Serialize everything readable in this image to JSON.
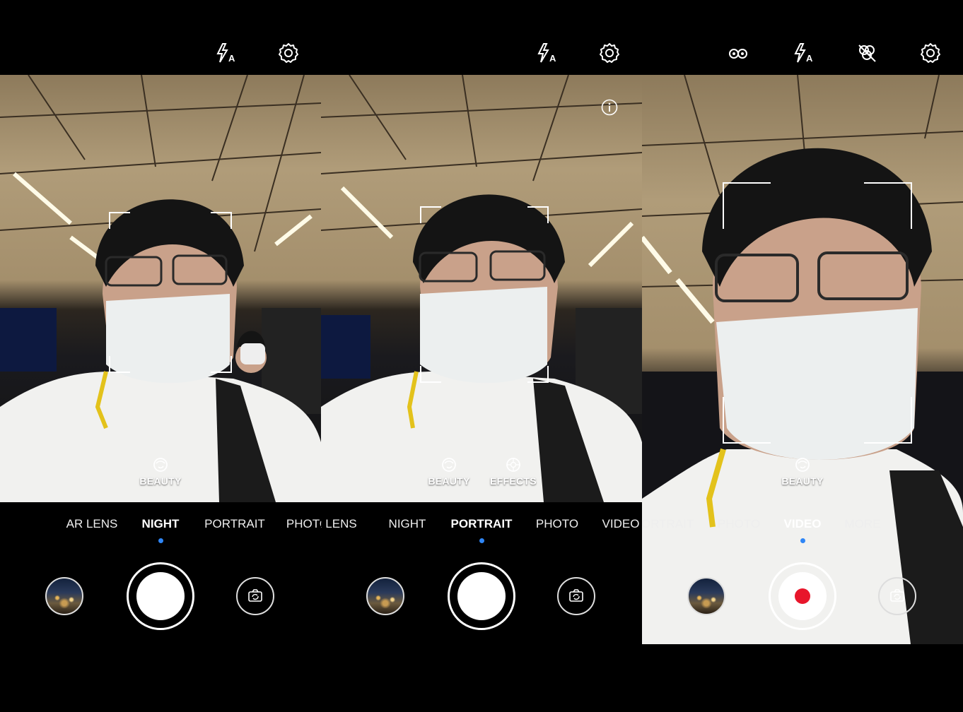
{
  "panels": [
    {
      "top_icons": [
        "flash-auto-icon",
        "settings-gear-icon"
      ],
      "viewfinder_chips": [
        {
          "icon": "beauty-face-icon",
          "label": "BEAUTY"
        }
      ],
      "modes": [
        "AR LENS",
        "NIGHT",
        "PORTRAIT",
        "PHOTO"
      ],
      "active_mode": "NIGHT",
      "shutter": "photo",
      "controls": [
        "gallery-thumbnail",
        "shutter-button",
        "switch-camera-button"
      ]
    },
    {
      "top_icons": [
        "flash-auto-icon",
        "settings-gear-icon",
        "info-icon"
      ],
      "viewfinder_chips": [
        {
          "icon": "beauty-face-icon",
          "label": "BEAUTY"
        },
        {
          "icon": "effects-aperture-icon",
          "label": "EFFECTS"
        }
      ],
      "modes": [
        "R LENS",
        "NIGHT",
        "PORTRAIT",
        "PHOTO",
        "VIDEO"
      ],
      "active_mode": "PORTRAIT",
      "shutter": "photo",
      "controls": [
        "gallery-thumbnail",
        "shutter-button",
        "switch-camera-button"
      ]
    },
    {
      "top_icons": [
        "glasses-icon",
        "flash-auto-icon",
        "filter-off-icon",
        "settings-gear-icon"
      ],
      "viewfinder_chips": [
        {
          "icon": "beauty-face-icon",
          "label": "BEAUTY"
        }
      ],
      "modes": [
        "ORTRAIT",
        "PHOTO",
        "VIDEO",
        "MORE"
      ],
      "active_mode": "VIDEO",
      "shutter": "record",
      "controls": [
        "gallery-thumbnail",
        "record-button",
        "switch-camera-button"
      ]
    }
  ],
  "colors": {
    "background": "#000000",
    "active_dot": "#2f86f6",
    "record_red": "#e8162b",
    "text": "#ffffff"
  }
}
